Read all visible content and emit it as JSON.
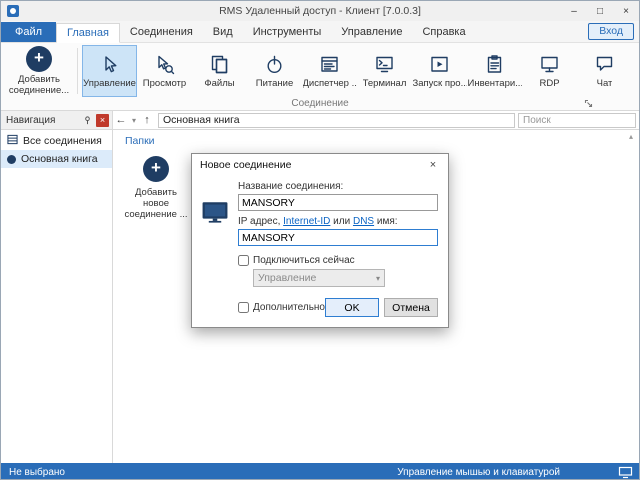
{
  "window": {
    "title": "RMS Удаленный доступ - Клиент [7.0.0.3]",
    "minimize": "–",
    "maximize": "□",
    "close": "×"
  },
  "menu": {
    "file_tab": "Файл",
    "tabs": [
      "Главная",
      "Соединения",
      "Вид",
      "Инструменты",
      "Управление",
      "Справка"
    ],
    "login": "Вход"
  },
  "ribbon": {
    "add_label": "Добавить соединение...",
    "group_label": "Соединение",
    "buttons": [
      "Управление",
      "Просмотр",
      "Файлы",
      "Питание",
      "Диспетчер ...",
      "Терминал",
      "Запуск про...",
      "Инвентари...",
      "RDP",
      "Чат"
    ]
  },
  "navbar": {
    "breadcrumb": "Основная книга",
    "search_placeholder": "Поиск"
  },
  "sidebar": {
    "title": "Навигация",
    "items": [
      "Все соединения",
      "Основная книга"
    ]
  },
  "main": {
    "section": "Папки",
    "tile": "Добавить новое соединение ..."
  },
  "dialog": {
    "title": "Новое соединение",
    "name_label": "Название соединения:",
    "name_value": "MANSORY",
    "addr_label_1": "IP адрес, ",
    "addr_link_1": "Internet-ID",
    "addr_label_2": " или ",
    "addr_link_2": "DNS",
    "addr_label_3": " имя:",
    "addr_value": "MANSORY",
    "connect_now": "Подключиться сейчас",
    "mode": "Управление",
    "advanced": "Дополнительно",
    "ok": "OK",
    "cancel": "Отмена"
  },
  "status": {
    "left": "Не выбрано",
    "right": "Управление мышью и клавиатурой"
  },
  "glyphs": {
    "plus": "+",
    "back": "←",
    "up": "↑",
    "chevron": "▾",
    "scroll_up": "▴",
    "nav_close": "×",
    "select_arrow": "▾"
  },
  "colors": {
    "accent_blue": "#2a6db8",
    "icon_navy": "#1f3d63",
    "selection": "#cde4f7"
  }
}
